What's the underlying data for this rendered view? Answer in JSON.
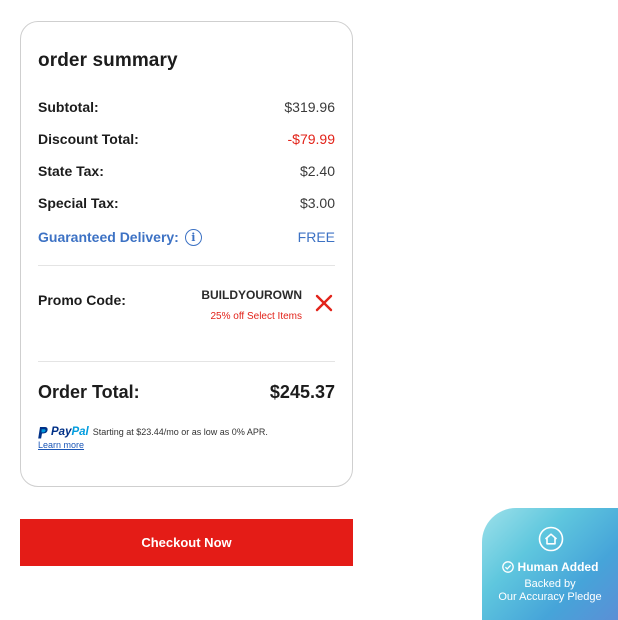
{
  "summary": {
    "title": "order summary",
    "rows": [
      {
        "label": "Subtotal:",
        "value": "$319.96"
      },
      {
        "label": "Discount Total:",
        "value": "-$79.99"
      },
      {
        "label": "State Tax:",
        "value": "$2.40"
      },
      {
        "label": "Special Tax:",
        "value": "$3.00"
      },
      {
        "label": "Guaranteed Delivery:",
        "value": "FREE"
      }
    ],
    "promo": {
      "label": "Promo Code:",
      "code": "BUILDYOUROWN",
      "description": "25% off Select Items"
    },
    "total": {
      "label": "Order Total:",
      "value": "$245.37"
    },
    "paypal": {
      "brand_pay": "Pay",
      "brand_pal": "Pal",
      "text": "Starting at $23.44/mo or as low as 0% APR.",
      "learn_more": "Learn more"
    }
  },
  "checkout_label": "Checkout Now",
  "badge": {
    "title": "Human Added",
    "line1": "Backed by",
    "line2": "Our Accuracy Pledge"
  },
  "colors": {
    "accent_red": "#e41c17",
    "delivery_blue": "#3d72c4",
    "paypal_navy": "#003087",
    "paypal_light": "#009cde"
  },
  "icons": [
    "info-icon",
    "close-icon",
    "paypal-logo-icon",
    "home-icon",
    "check-circle-icon"
  ]
}
